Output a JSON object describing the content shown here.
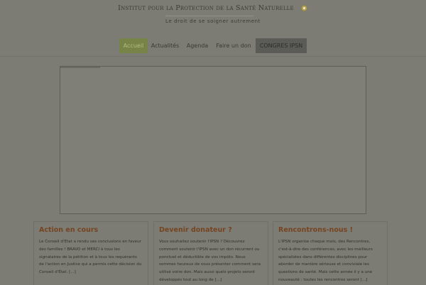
{
  "header": {
    "site_title": "Institut pour la Protection de la Santé Naturelle",
    "tagline": "Le droit de se soigner autrement",
    "logo_icon": "seal-icon"
  },
  "nav": {
    "items": [
      {
        "label": "Accueil",
        "state": "active"
      },
      {
        "label": "Actualités",
        "state": "normal"
      },
      {
        "label": "Agenda",
        "state": "normal"
      },
      {
        "label": "Faire un don",
        "state": "normal"
      },
      {
        "label": "CONGRES IPSN",
        "state": "highlight"
      }
    ]
  },
  "columns": [
    {
      "title": "Action en cours",
      "text": "Le Conseil d'Etat a rendu ses conclusions en faveur des familles ! BRAVO et MERCI à tous les signataires de la pétition et à tous les requérants de l'action en Justice qui a permis cette décision du Conseil d'État. [...]"
    },
    {
      "title": "Devenir donateur ?",
      "text": "Vous souhaitez soutenir l'IPSN ? Découvrez comment soutenir l'IPSN avec un don récurrent ou ponctuel et déductible de vos impôts. Nous sommes heureux de vous présenter comment sera utilisé votre don. Mais aussi quels projets seront développés tout au long de [...]"
    },
    {
      "title": "Rencontrons-nous !",
      "text": "L'IPSN organise chaque mois, des Rencontres, c'est-à-dire des conférences, avec les meilleurs spécialistes dans différentes disciplines pour aborder de manière sérieuse et conviviale les questions de santé. Mais cette année il y a une nouveauté : toutes les rencontres seront [...]"
    }
  ],
  "colors": {
    "overlay_background": "#7c7c74",
    "nav_active": "#778447",
    "nav_highlight": "#5b5b57",
    "column_title": "#764420"
  }
}
